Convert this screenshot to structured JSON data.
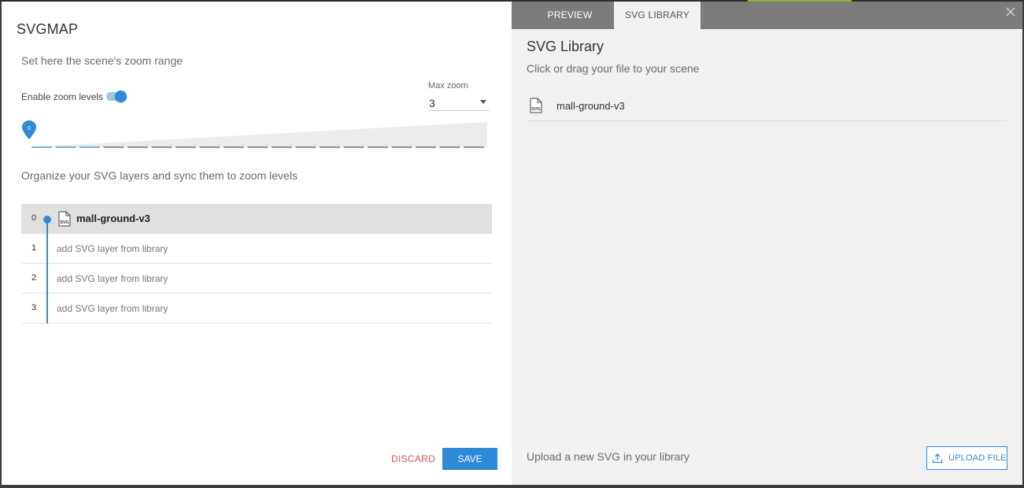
{
  "left": {
    "title": "SVGMAP",
    "zoom_heading": "Set here the scene's zoom range",
    "enable_label": "Enable zoom levels",
    "enable_on": true,
    "max_zoom_label": "Max zoom",
    "max_zoom_value": "3",
    "zoom_marker_value": "0",
    "organize_heading": "Organize your SVG layers and sync them to zoom levels",
    "layers": [
      {
        "num": "0",
        "name": "mall-ground-v3"
      },
      {
        "num": "1",
        "add": "add SVG layer from library"
      },
      {
        "num": "2",
        "add": "add SVG layer from library"
      },
      {
        "num": "3",
        "add": "add SVG layer from library"
      }
    ],
    "discard_label": "DISCARD",
    "save_label": "SAVE"
  },
  "right": {
    "tabs": [
      {
        "label": "PREVIEW"
      },
      {
        "label": "SVG LIBRARY"
      }
    ],
    "lib_title": "SVG Library",
    "lib_sub": "Click or drag your file to your scene",
    "items": [
      {
        "name": "mall-ground-v3"
      }
    ],
    "upload_text": "Upload a new SVG in your library",
    "upload_label": "UPLOAD FILE"
  },
  "icons": {
    "file": "svg-file-icon",
    "close": "close-icon",
    "upload": "upload-icon",
    "marker": "map-pin-icon"
  },
  "colors": {
    "accent": "#2e8ad8",
    "danger": "#d9534f",
    "tabbar": "#7c7c7c",
    "panel_right": "#f1f1f1",
    "active_row": "#e0e0e0"
  }
}
